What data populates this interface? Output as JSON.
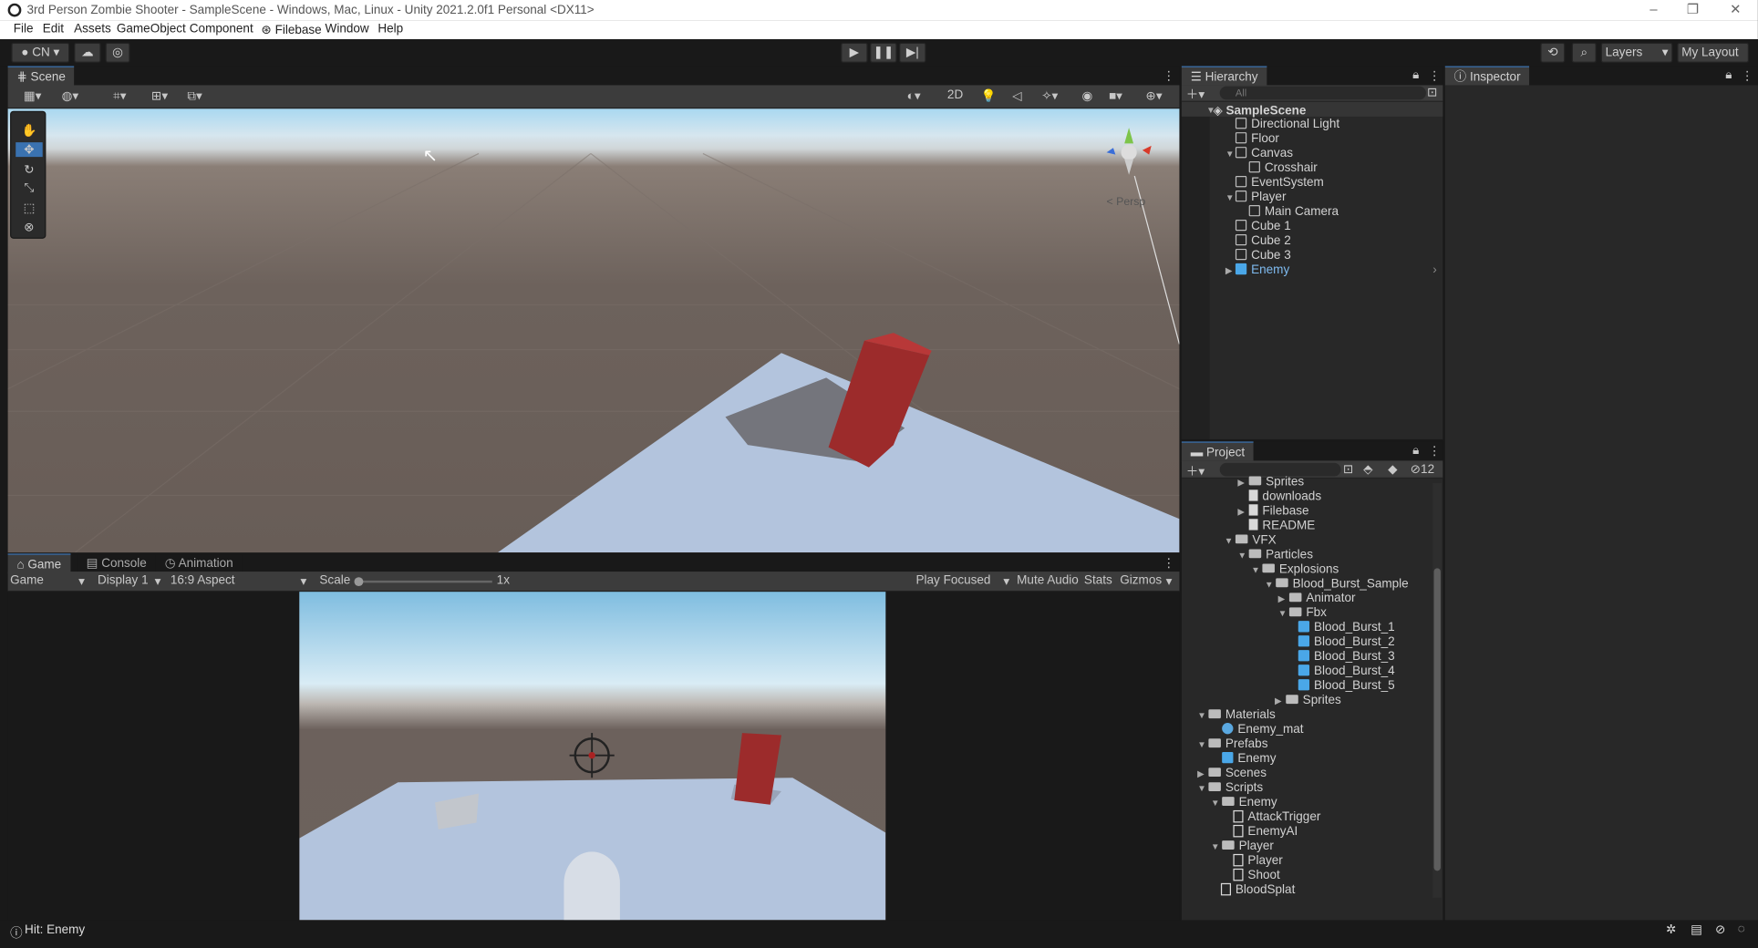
{
  "window": {
    "title": "3rd Person Zombie Shooter - SampleScene - Windows, Mac, Linux - Unity 2021.2.0f1 Personal <DX11>"
  },
  "menu": [
    "File",
    "Edit",
    "Assets",
    "GameObject",
    "Component",
    "Filebase",
    "Window",
    "Help"
  ],
  "toolbar": {
    "account": "CN",
    "layers": "Layers",
    "layout": "My Layout"
  },
  "scene_panel": {
    "tab": "Scene",
    "mode_2d": "2D",
    "persp": "< Persp"
  },
  "game_panel": {
    "tabs": [
      "Game",
      "Console",
      "Animation"
    ],
    "view": "Game",
    "display": "Display 1",
    "aspect": "16:9 Aspect",
    "scale_label": "Scale",
    "scale_value": "1x",
    "play_focused": "Play Focused",
    "mute": "Mute Audio",
    "stats": "Stats",
    "gizmos": "Gizmos"
  },
  "hierarchy": {
    "tab": "Hierarchy",
    "search_placeholder": "All",
    "items": [
      "SampleScene",
      "Directional Light",
      "Floor",
      "Canvas",
      "Crosshair",
      "EventSystem",
      "Player",
      "Main Camera",
      "Cube 1",
      "Cube 2",
      "Cube 3",
      "Enemy"
    ]
  },
  "inspector": {
    "tab": "Inspector"
  },
  "project": {
    "tab": "Project",
    "hidden_count": "12",
    "items": [
      "Sprites",
      "downloads",
      "Filebase",
      "README",
      "VFX",
      "Particles",
      "Explosions",
      "Blood_Burst_Sample",
      "Animator",
      "Fbx",
      "Blood_Burst_1",
      "Blood_Burst_2",
      "Blood_Burst_3",
      "Blood_Burst_4",
      "Blood_Burst_5",
      "Sprites",
      "Materials",
      "Enemy_mat",
      "Prefabs",
      "Enemy",
      "Scenes",
      "Scripts",
      "Enemy",
      "AttackTrigger",
      "EnemyAI",
      "Player",
      "Player",
      "Shoot",
      "BloodSplat"
    ]
  },
  "status": {
    "message": "Hit: Enemy"
  },
  "colors": {
    "accent": "#3a72b0",
    "selection": "#4aa7e8",
    "enemy": "#9c2b2b"
  }
}
